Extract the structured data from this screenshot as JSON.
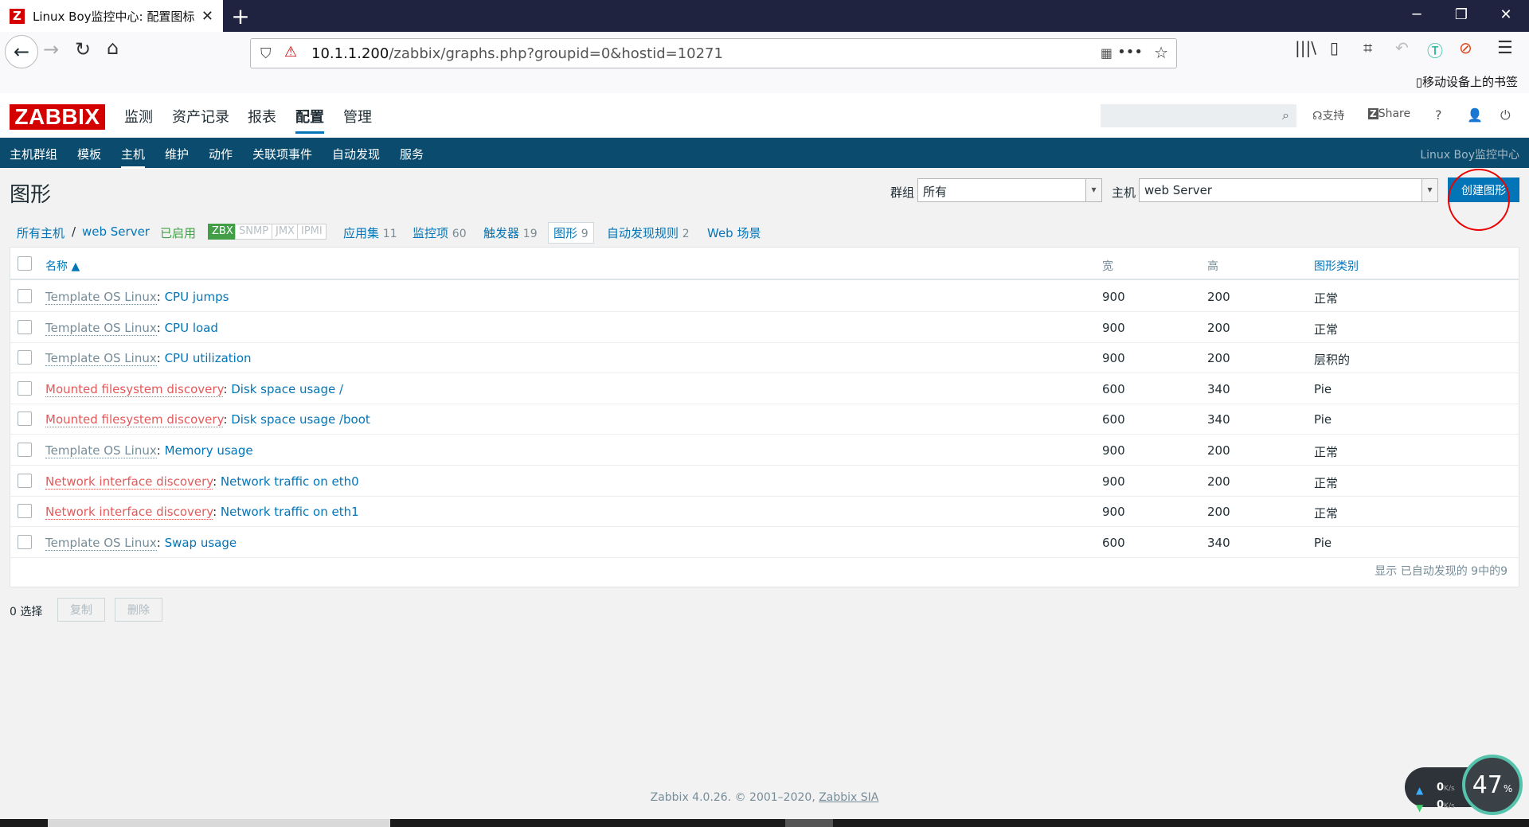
{
  "browser": {
    "tab_title": "Linux Boy监控中心: 配置图标",
    "favicon_letter": "Z",
    "url_host": "10.1.1.200",
    "url_path": "/zabbix/graphs.php?groupid=0&hostid=10271",
    "mobile_bookmarks": "移动设备上的书签"
  },
  "header": {
    "logo": "ZABBIX",
    "menu": [
      "监测",
      "资产记录",
      "报表",
      "配置",
      "管理"
    ],
    "active_menu": "配置",
    "support": "支持",
    "share": "Share",
    "help": "?"
  },
  "submenu": {
    "items": [
      "主机群组",
      "模板",
      "主机",
      "维护",
      "动作",
      "关联项事件",
      "自动发现",
      "服务"
    ],
    "active": "主机",
    "right_text": "Linux Boy监控中心"
  },
  "page": {
    "title": "图形",
    "group_label": "群组",
    "group_value": "所有",
    "host_label": "主机",
    "host_value": "web Server",
    "create_button": "创建图形"
  },
  "host_nav": {
    "all_hosts": "所有主机",
    "separator": "/",
    "host": "web Server",
    "enabled": "已启用",
    "badges": [
      "ZBX",
      "SNMP",
      "JMX",
      "IPMI"
    ],
    "links": [
      {
        "label": "应用集",
        "count": "11"
      },
      {
        "label": "监控项",
        "count": "60"
      },
      {
        "label": "触发器",
        "count": "19"
      },
      {
        "label": "图形",
        "count": "9"
      },
      {
        "label": "自动发现规则",
        "count": "2"
      },
      {
        "label": "Web 场景",
        "count": ""
      }
    ]
  },
  "table": {
    "columns": [
      "名称 ▲",
      "宽",
      "高",
      "图形类别"
    ],
    "rows": [
      {
        "prefix": "Template OS Linux",
        "prefix_type": "template",
        "name": "CPU jumps",
        "width": "900",
        "height": "200",
        "type": "正常"
      },
      {
        "prefix": "Template OS Linux",
        "prefix_type": "template",
        "name": "CPU load",
        "width": "900",
        "height": "200",
        "type": "正常"
      },
      {
        "prefix": "Template OS Linux",
        "prefix_type": "template",
        "name": "CPU utilization",
        "width": "900",
        "height": "200",
        "type": "层积的"
      },
      {
        "prefix": "Mounted filesystem discovery",
        "prefix_type": "discovery",
        "name": "Disk space usage /",
        "width": "600",
        "height": "340",
        "type": "Pie"
      },
      {
        "prefix": "Mounted filesystem discovery",
        "prefix_type": "discovery",
        "name": "Disk space usage /boot",
        "width": "600",
        "height": "340",
        "type": "Pie"
      },
      {
        "prefix": "Template OS Linux",
        "prefix_type": "template",
        "name": "Memory usage",
        "width": "900",
        "height": "200",
        "type": "正常"
      },
      {
        "prefix": "Network interface discovery",
        "prefix_type": "discovery",
        "name": "Network traffic on eth0",
        "width": "900",
        "height": "200",
        "type": "正常"
      },
      {
        "prefix": "Network interface discovery",
        "prefix_type": "discovery",
        "name": "Network traffic on eth1",
        "width": "900",
        "height": "200",
        "type": "正常"
      },
      {
        "prefix": "Template OS Linux",
        "prefix_type": "template",
        "name": "Swap usage",
        "width": "600",
        "height": "340",
        "type": "Pie"
      }
    ],
    "footer": "显示 已自动发现的 9中的9"
  },
  "actions": {
    "selected": "0 选择",
    "copy": "复制",
    "delete": "删除"
  },
  "footer": {
    "text": "Zabbix 4.0.26. © 2001–2020, ",
    "link": "Zabbix SIA"
  },
  "net_widget": {
    "up": "0",
    "down": "0",
    "unit": "K/s",
    "percent": "47",
    "percent_sign": "%"
  },
  "colors": {
    "brand_red": "#d40000",
    "accent_blue": "#0275b8",
    "submenu_bg": "#0b4c6e",
    "discovery_red": "#e45959",
    "enabled_green": "#429e47"
  }
}
